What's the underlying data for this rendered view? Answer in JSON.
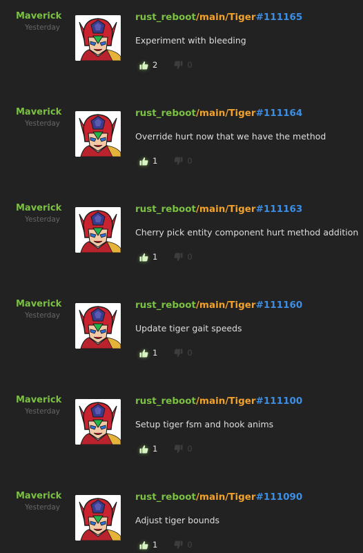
{
  "colors": {
    "background": "#222222",
    "author": "#7bc142",
    "repo": "#7bc142",
    "branch": "#f2a12b",
    "revision": "#3d8fe6",
    "message": "#dddddd",
    "timestamp": "#676767",
    "downvote": "#444444"
  },
  "icons": {
    "avatar": "red-armored-helmet-character",
    "upvote": "thumbs-up-icon",
    "downvote": "thumbs-down-icon"
  },
  "entries": [
    {
      "author": "Maverick",
      "time": "Yesterday",
      "repo": "rust_reboot",
      "branch": "/main/Tiger",
      "rev": "#111165",
      "message": "Experiment with bleeding",
      "up": "2",
      "down": "0"
    },
    {
      "author": "Maverick",
      "time": "Yesterday",
      "repo": "rust_reboot",
      "branch": "/main/Tiger",
      "rev": "#111164",
      "message": "Override hurt now that we have the method",
      "up": "1",
      "down": "0"
    },
    {
      "author": "Maverick",
      "time": "Yesterday",
      "repo": "rust_reboot",
      "branch": "/main/Tiger",
      "rev": "#111163",
      "message": "Cherry pick entity component hurt method addition",
      "up": "1",
      "down": "0"
    },
    {
      "author": "Maverick",
      "time": "Yesterday",
      "repo": "rust_reboot",
      "branch": "/main/Tiger",
      "rev": "#111160",
      "message": "Update tiger gait speeds",
      "up": "1",
      "down": "0"
    },
    {
      "author": "Maverick",
      "time": "Yesterday",
      "repo": "rust_reboot",
      "branch": "/main/Tiger",
      "rev": "#111100",
      "message": "Setup tiger fsm and hook anims",
      "up": "1",
      "down": "0"
    },
    {
      "author": "Maverick",
      "time": "Yesterday",
      "repo": "rust_reboot",
      "branch": "/main/Tiger",
      "rev": "#111090",
      "message": "Adjust tiger bounds",
      "up": "1",
      "down": "0"
    }
  ]
}
